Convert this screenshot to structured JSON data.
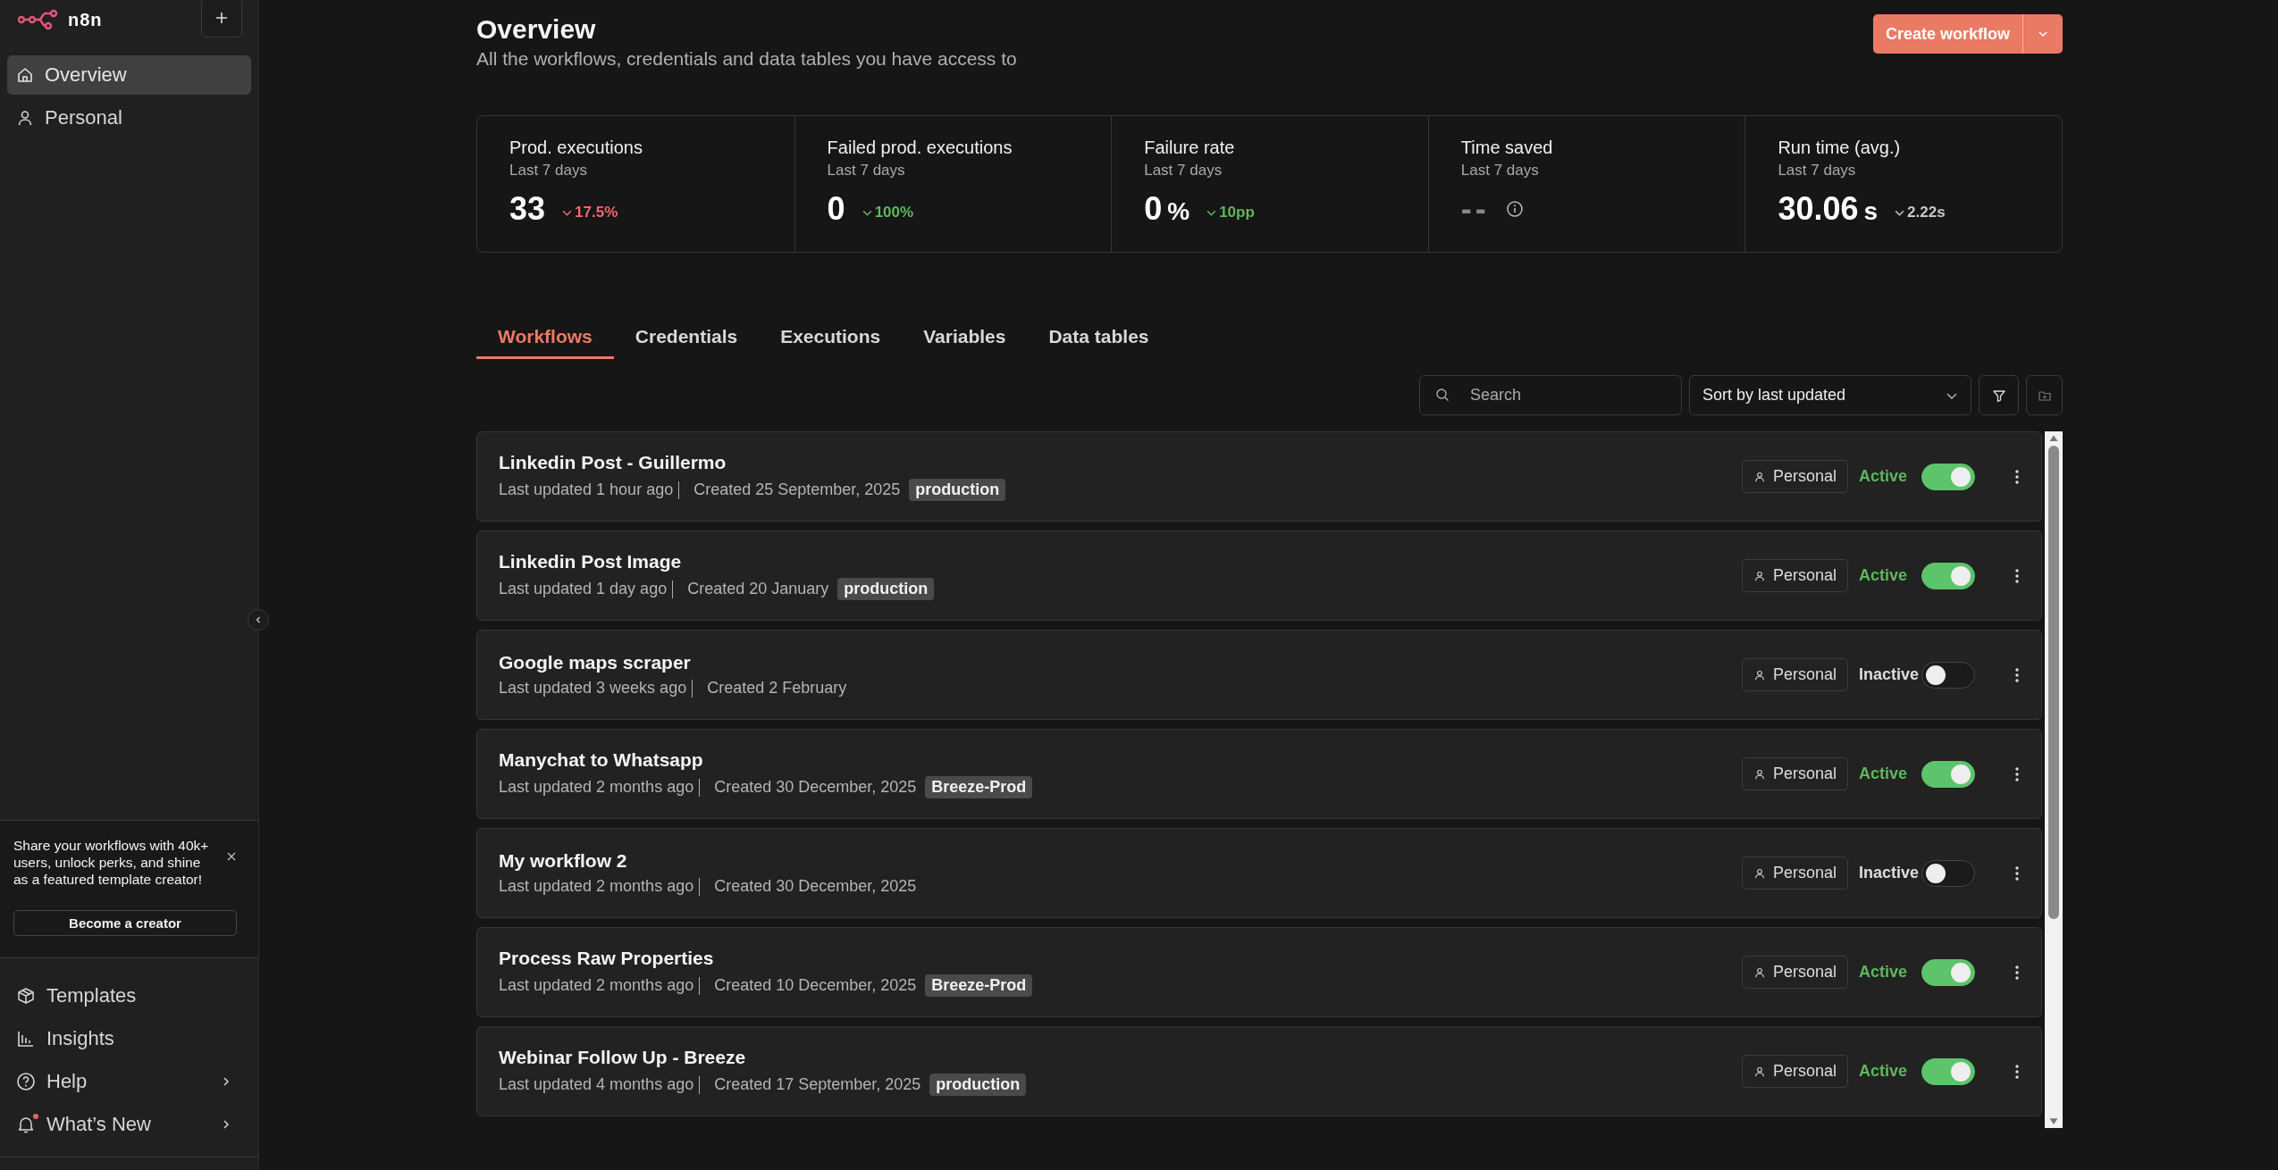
{
  "sidebar": {
    "logo": "n8n",
    "nav": [
      {
        "label": "Overview",
        "selected": true
      },
      {
        "label": "Personal",
        "selected": false
      }
    ],
    "promo": {
      "text": "Share your workflows with 40k+ users, unlock perks, and shine as a featured template creator!",
      "button": "Become a creator"
    },
    "bottom_nav": [
      {
        "label": "Templates",
        "submenu": false,
        "badge": false
      },
      {
        "label": "Insights",
        "submenu": false,
        "badge": false
      },
      {
        "label": "Help",
        "submenu": true,
        "badge": false
      },
      {
        "label": "What’s New",
        "submenu": true,
        "badge": true
      }
    ]
  },
  "header": {
    "title": "Overview",
    "subtitle": "All the workflows, credentials and data tables you have access to",
    "create_button": "Create workflow"
  },
  "stats": [
    {
      "title": "Prod. executions",
      "period": "Last 7 days",
      "value": "33",
      "delta": "17.5%",
      "color": "#f0686a",
      "kind": "value"
    },
    {
      "title": "Failed prod. executions",
      "period": "Last 7 days",
      "value": "0",
      "delta": "100%",
      "color": "#5cb85c",
      "kind": "value"
    },
    {
      "title": "Failure rate",
      "period": "Last 7 days",
      "value": "0",
      "unit": "%",
      "delta": "10pp",
      "color": "#5cb85c",
      "kind": "value"
    },
    {
      "title": "Time saved",
      "period": "Last 7 days",
      "value": "--",
      "kind": "empty"
    },
    {
      "title": "Run time (avg.)",
      "period": "Last 7 days",
      "value": "30.06",
      "unit": "s",
      "delta": "2.22s",
      "color": "#c8c8c8",
      "kind": "value"
    }
  ],
  "tabs": [
    {
      "label": "Workflows",
      "selected": true
    },
    {
      "label": "Credentials",
      "selected": false
    },
    {
      "label": "Executions",
      "selected": false
    },
    {
      "label": "Variables",
      "selected": false
    },
    {
      "label": "Data tables",
      "selected": false
    }
  ],
  "search": {
    "placeholder": "Search"
  },
  "sort": {
    "value": "Sort by last updated"
  },
  "workflows": [
    {
      "name": "Linkedin Post - Guillermo",
      "updated": "Last updated 1 hour ago",
      "created": "Created 25 September, 2025",
      "tag": "production",
      "owner": "Personal",
      "status": "Active",
      "on": true
    },
    {
      "name": "Linkedin Post Image",
      "updated": "Last updated 1 day ago",
      "created": "Created 20 January",
      "tag": "production",
      "owner": "Personal",
      "status": "Active",
      "on": true
    },
    {
      "name": "Google maps scraper",
      "updated": "Last updated 3 weeks ago",
      "created": "Created 2 February",
      "owner": "Personal",
      "status": "Inactive",
      "on": false
    },
    {
      "name": "Manychat to Whatsapp",
      "updated": "Last updated 2 months ago",
      "created": "Created 30 December, 2025",
      "tag": "Breeze-Prod",
      "owner": "Personal",
      "status": "Active",
      "on": true
    },
    {
      "name": "My workflow 2",
      "updated": "Last updated 2 months ago",
      "created": "Created 30 December, 2025",
      "owner": "Personal",
      "status": "Inactive",
      "on": false
    },
    {
      "name": "Process Raw Properties",
      "updated": "Last updated 2 months ago",
      "created": "Created 10 December, 2025",
      "tag": "Breeze-Prod",
      "owner": "Personal",
      "status": "Active",
      "on": true
    },
    {
      "name": "Webinar Follow Up - Breeze",
      "updated": "Last updated 4 months ago",
      "created": "Created 17 September, 2025",
      "tag": "production",
      "owner": "Personal",
      "status": "Active",
      "on": true
    }
  ]
}
